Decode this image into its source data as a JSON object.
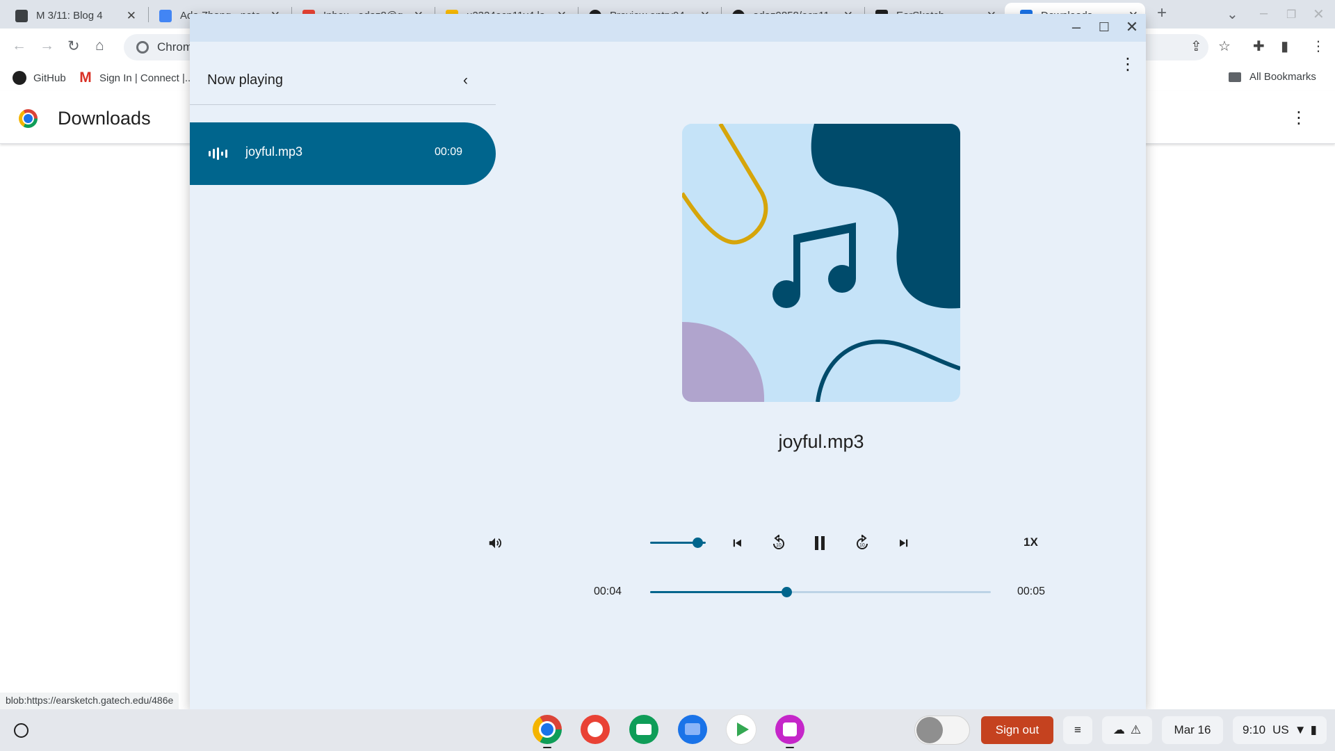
{
  "browser": {
    "tabs": [
      {
        "title": "M 3/11: Blog 4",
        "favicon_color": "#3c4043"
      },
      {
        "title": "Ada Zhang - note…",
        "favicon_color": "#4285f4"
      },
      {
        "title": "Inbox - adaz8@g…",
        "favicon_color": "#ea4335"
      },
      {
        "title": "u2324ecp11v4 la…",
        "favicon_color": "#fbbc04"
      },
      {
        "title": "Preview entry04…",
        "favicon_color": "#1f1f1f"
      },
      {
        "title": "adaz9858/ecp11…",
        "favicon_color": "#1f1f1f"
      },
      {
        "title": "EarSketch",
        "favicon_color": "#1f1f1f"
      },
      {
        "title": "Downloads",
        "favicon_color": "#1a73e8"
      }
    ],
    "new_tab_label": "+",
    "omnibox_text": "Chrome | chrome://downloads",
    "bookmarks": [
      {
        "label": "GitHub"
      },
      {
        "label": "Sign In | Connect |..."
      }
    ],
    "all_bookmarks_label": "All Bookmarks",
    "page_title": "Downloads",
    "status_url": "blob:https://earsketch.gatech.edu/486e"
  },
  "media_app": {
    "sidebar": {
      "header": "Now playing",
      "tracks": [
        {
          "name": "joyful.mp3",
          "duration": "00:09"
        }
      ]
    },
    "now_playing_title": "joyful.mp3",
    "volume_level": 0.85,
    "playback_speed": "1X",
    "time_current": "00:04",
    "time_remaining": "00:05",
    "progress_fraction": 0.4,
    "accent_color": "#00658d",
    "icons": [
      "volume-icon",
      "skip-previous-icon",
      "replay-10-icon",
      "pause-icon",
      "forward-10-icon",
      "skip-next-icon",
      "more-vert-icon",
      "collapse-icon"
    ]
  },
  "shelf": {
    "apps": [
      "Chrome",
      "Canvas",
      "Classroom",
      "Files",
      "Play Store",
      "Gallery"
    ],
    "sign_out_label": "Sign out",
    "date": "Mar 16",
    "time": "9:10",
    "locale": "US"
  }
}
